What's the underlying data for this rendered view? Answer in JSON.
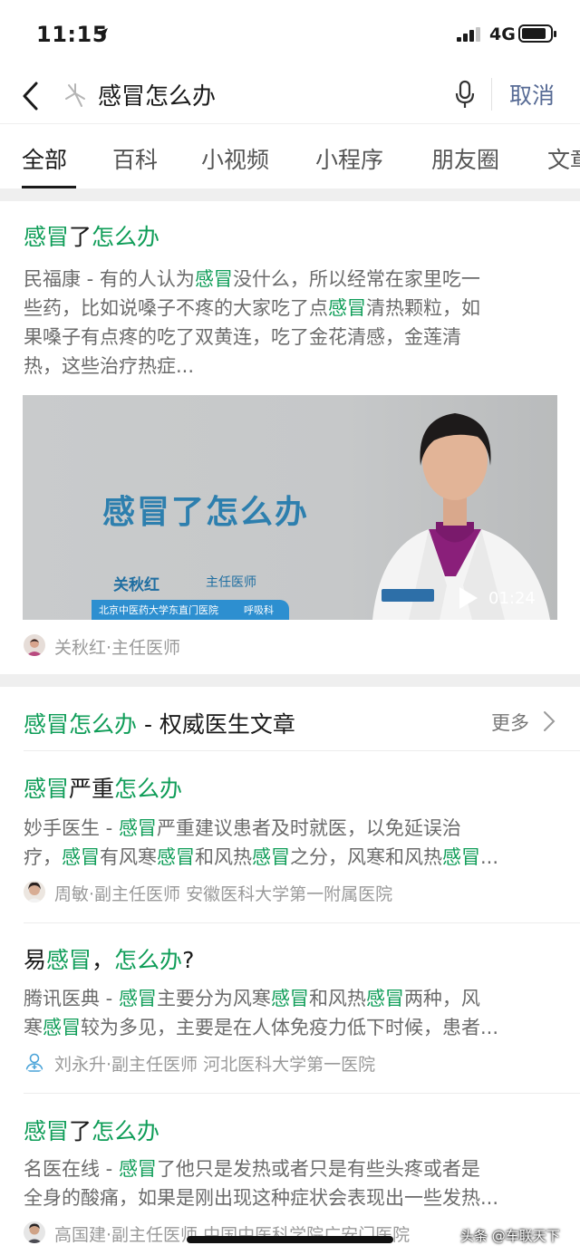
{
  "status": {
    "time": "11:15",
    "network": "4G"
  },
  "search": {
    "query": "感冒怎么办",
    "cancel": "取消"
  },
  "tabs": [
    "全部",
    "百科",
    "小视频",
    "小程序",
    "朋友圈",
    "文章"
  ],
  "card1": {
    "title": [
      "感冒",
      "了",
      "怎么办"
    ],
    "snippet_lines": [
      [
        "民福康 - 有的人认为",
        "感冒",
        "没什么，所以经常在家里吃一"
      ],
      [
        "些药，比如说嗓子不疼的大家吃了点",
        "感冒",
        "清热颗粒，如"
      ],
      [
        "果嗓子有点疼的吃了双黄连，吃了金花清感，金莲清"
      ],
      [
        "热，这些治疗热症..."
      ]
    ],
    "video": {
      "title": "感冒了怎么办",
      "doctor_name": "关秋红",
      "doctor_role": "主任医师",
      "hospital": "北京中医药大学东直门医院",
      "dept": "呼吸科",
      "duration": "01:24"
    },
    "byline": "关秋红·主任医师"
  },
  "section": {
    "title_parts": [
      "感冒怎么办",
      " - 权威医生文章"
    ],
    "more": "更多"
  },
  "articles": [
    {
      "title": [
        [
          "感冒",
          true
        ],
        [
          "严重",
          false
        ],
        [
          "怎么办",
          true
        ]
      ],
      "lines": [
        [
          [
            "妙手医生 - ",
            false
          ],
          [
            "感冒",
            true
          ],
          [
            "严重建议患者及时就医，以免延误治",
            false
          ]
        ],
        [
          [
            "疗，",
            false
          ],
          [
            "感冒",
            true
          ],
          [
            "有风寒",
            false
          ],
          [
            "感冒",
            true
          ],
          [
            "和风热",
            false
          ],
          [
            "感冒",
            true
          ],
          [
            "之分，风寒和风热",
            false
          ],
          [
            "感冒",
            true
          ],
          [
            "...",
            false
          ]
        ]
      ],
      "byline": "周敏·副主任医师 安徽医科大学第一附属医院"
    },
    {
      "title": [
        [
          "易",
          false
        ],
        [
          "感冒",
          true
        ],
        [
          "，",
          false
        ],
        [
          "怎么办",
          true
        ],
        [
          "?",
          false
        ]
      ],
      "lines": [
        [
          [
            "腾讯医典 - ",
            false
          ],
          [
            "感冒",
            true
          ],
          [
            "主要分为风寒",
            false
          ],
          [
            "感冒",
            true
          ],
          [
            "和风热",
            false
          ],
          [
            "感冒",
            true
          ],
          [
            "两种，风",
            false
          ]
        ],
        [
          [
            "寒",
            false
          ],
          [
            "感冒",
            true
          ],
          [
            "较为多见，主要是在人体免疫力低下时候，患者...",
            false
          ]
        ]
      ],
      "byline": "刘永升·副主任医师 河北医科大学第一医院"
    },
    {
      "title": [
        [
          "感冒",
          true
        ],
        [
          "了",
          false
        ],
        [
          "怎么办",
          true
        ]
      ],
      "lines": [
        [
          [
            "名医在线 - ",
            false
          ],
          [
            "感冒",
            true
          ],
          [
            "了他只是发热或者只是有些头疼或者是",
            false
          ]
        ],
        [
          [
            "全身的酸痛，如果是刚出现这种症状会表现出一些发热...",
            false
          ]
        ]
      ],
      "byline": "高国建·副主任医师 中国中医科学院广安门医院"
    }
  ],
  "watermark": "头条 @车联天下",
  "colors": {
    "highlight": "#0f9d58",
    "cancel": "#576b95",
    "separator": "#efefef"
  }
}
